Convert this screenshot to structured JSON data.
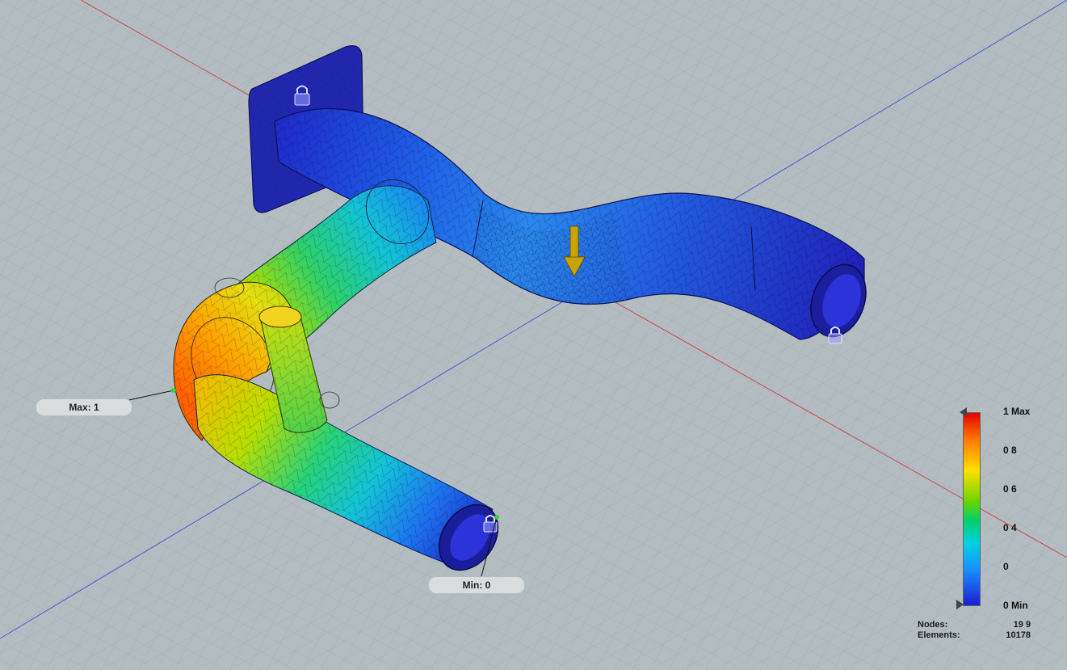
{
  "viewport": {
    "background": "#b2bbbf",
    "grid_color": "#9aa4a8",
    "x_axis_color": "#d23b3b",
    "y_axis_color": "#3b56d6"
  },
  "callouts": {
    "max_label": "Max: 1",
    "min_label": "Min: 0"
  },
  "legend": {
    "labels": [
      "1 Max",
      "0 8",
      "0 6",
      "0 4",
      "0",
      "0 Min"
    ],
    "max_value": 1,
    "min_value": 0
  },
  "stats": {
    "nodes_label": "Nodes:",
    "nodes_value": "19 9",
    "elements_label": "Elements:",
    "elements_value": "10178"
  },
  "icons": [
    "lock-icon",
    "load-arrow-icon",
    "result-marker-icon"
  ]
}
